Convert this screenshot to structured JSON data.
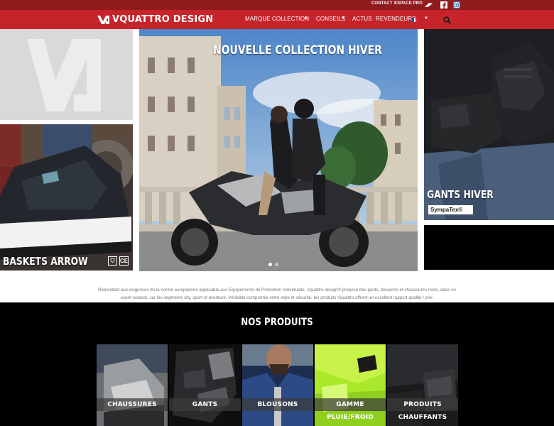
{
  "topbar": {
    "contact": "CONTACT",
    "espace_pro": "ESPACE PRO",
    "icons": [
      "brand-icon",
      "facebook-icon",
      "instagram-icon"
    ]
  },
  "nav": {
    "brand": "VQUATTRO DESIGN",
    "items": [
      "MARQUE",
      "COLLECTION",
      "CONSEILS",
      "ACTUS",
      "REVENDEURS"
    ],
    "language_flag": "fr",
    "colors": {
      "topbar": "#8f1b1d",
      "navbar": "#c6232a"
    }
  },
  "hero": {
    "center_caption": "NOUVELLE COLLECTION HIVER",
    "shoe_caption": "BASKETS ARROW",
    "gloves_caption": "GANTS HIVER",
    "sympatex_badge": "SympaTex®",
    "ce_badge": "CE",
    "carousel_slides": 2,
    "active_slide": 1
  },
  "intro": {
    "text": "Répondant aux exigences de la norme européenne applicable aux Equipements de Protection Individuelle, Vquattro design® propose des gants, blousons et chaussures moto, dans un esprit outdoor, sur les segments city, sport et aventure. Véritable compromis entre style et sécurité, les produits Vquattro offrent un excellent rapport qualité / prix."
  },
  "products": {
    "title": "NOS PRODUITS",
    "items": [
      "CHAUSSURES",
      "GANTS",
      "BLOUSONS",
      "GAMME PLUIE/FROID",
      "PRODUITS CHAUFFANTS"
    ]
  }
}
